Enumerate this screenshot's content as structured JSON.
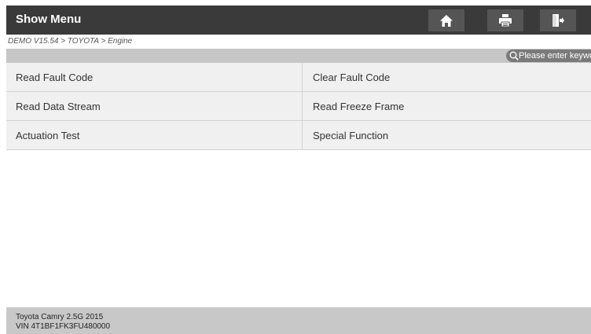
{
  "header": {
    "title": "Show Menu",
    "buttons": [
      "home",
      "print",
      "exit"
    ]
  },
  "breadcrumb": "DEMO V15.54 > TOYOTA > Engine",
  "search": {
    "placeholder": "Please enter keyword"
  },
  "menu": {
    "items": [
      {
        "label": "Read Fault Code"
      },
      {
        "label": "Clear Fault Code"
      },
      {
        "label": "Read Data Stream"
      },
      {
        "label": "Read Freeze Frame"
      },
      {
        "label": "Actuation Test"
      },
      {
        "label": "Special Function"
      }
    ]
  },
  "footer": {
    "vehicle": "Toyota Camry 2.5G 2015",
    "vin": "VIN 4T1BF1FK3FU480000"
  },
  "colors": {
    "titlebar": "#3a3a3a",
    "button": "#555555",
    "searchbar": "#c6c6c6",
    "footer": "#c8c8c8",
    "cell": "#f0f0f0"
  },
  "icons": [
    "home-icon",
    "print-icon",
    "exit-icon",
    "search-icon"
  ]
}
